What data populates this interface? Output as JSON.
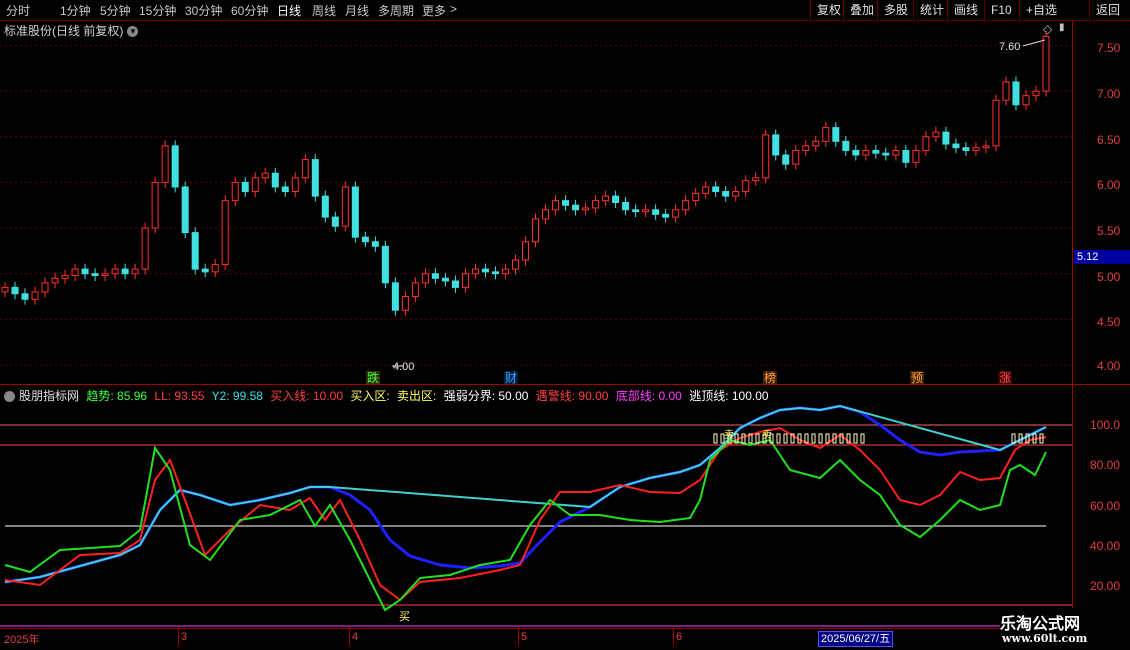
{
  "toolbar": {
    "periods": [
      "分时",
      "1分钟",
      "5分钟",
      "15分钟",
      "30分钟",
      "60分钟",
      "日线",
      "周线",
      "月线",
      "多周期",
      "更多"
    ],
    "active_index": 6,
    "more_arrow": ">",
    "right_buttons": [
      "复权",
      "叠加",
      "多股",
      "统计",
      "画线",
      "F10",
      "+自选",
      "返回"
    ]
  },
  "stock": {
    "title": "标准股份(日线 前复权)",
    "title_button": "▾",
    "right_icons": [
      "◇",
      "▮"
    ],
    "last_price_tag": "5.12"
  },
  "price_axis": [
    "7.50",
    "7.00",
    "6.50",
    "6.00",
    "5.50",
    "5.00",
    "4.50",
    "4.00"
  ],
  "price_annotations": {
    "high_label": "7.60",
    "low_label": "4.00"
  },
  "event_markers": [
    {
      "label": "跌",
      "color": "#40ff40"
    },
    {
      "label": "财",
      "color": "#40a0ff"
    },
    {
      "label": "榜",
      "color": "#ffa040"
    },
    {
      "label": "预",
      "color": "#ffa040"
    },
    {
      "label": "涨",
      "color": "#ff5050"
    }
  ],
  "indicator": {
    "name": "股朋指标网",
    "params": [
      {
        "text": "趋势: 85.96",
        "color": "#40ff40"
      },
      {
        "text": "LL: 93.55",
        "color": "#ff4040"
      },
      {
        "text": "Y2: 99.58",
        "color": "#40e0e0"
      },
      {
        "text": "买入线: 10.00",
        "color": "#ff4040"
      },
      {
        "text": "买入区:",
        "color": "#ffff60"
      },
      {
        "text": "卖出区:",
        "color": "#ffff60"
      },
      {
        "text": "强弱分界: 50.00",
        "color": "#ffffff"
      },
      {
        "text": "遇警线: 90.00",
        "color": "#ff4040"
      },
      {
        "text": "底部线: 0.00",
        "color": "#ff40ff"
      },
      {
        "text": "逃顶线: 100.00",
        "color": "#ffffff"
      }
    ],
    "axis": [
      "100.0",
      "80.00",
      "60.00",
      "40.00",
      "20.00"
    ],
    "signal_buy": "买",
    "signal_sell": "卖"
  },
  "date_axis": {
    "labels": [
      "2025年",
      "3",
      "4",
      "5",
      "6"
    ],
    "cursor_date": "2025/06/27/五"
  },
  "watermark": {
    "line1": "乐淘公式网",
    "line2": "www.60lt.com"
  },
  "colors": {
    "up": "#ff3030",
    "down": "#40e0e0",
    "grid": "#5a0000",
    "trend": "#20e020",
    "ll": "#ff2020",
    "y2_up": "#40d0d0",
    "y2_down": "#2020ff"
  }
}
